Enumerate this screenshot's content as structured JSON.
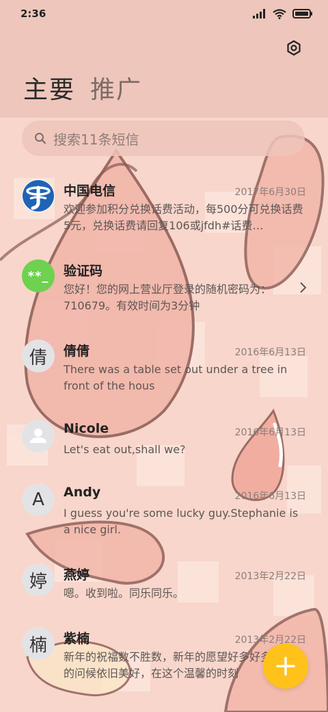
{
  "status_bar": {
    "time": "2:36"
  },
  "tabs": [
    {
      "label": "主要",
      "active": true
    },
    {
      "label": "推广",
      "active": false
    }
  ],
  "search": {
    "placeholder": "搜索11条短信"
  },
  "conversations": [
    {
      "name": "中国电信",
      "date": "2017年6月30日",
      "preview": "欢迎参加积分兑换话费活动，每500分可兑换话费5元，兑换话费请回复106或jfdh#话费…",
      "avatar": "telecom-logo"
    },
    {
      "name": "验证码",
      "date": "",
      "preview": "您好！您的网上营业厅登录的随机密码为：710679。有效时间为3分钟",
      "avatar_text": "**_"
    },
    {
      "name": "倩倩",
      "date": "2016年6月13日",
      "preview": "There was a table set out under a tree in front of the hous",
      "avatar_text": "倩"
    },
    {
      "name": "Nicole",
      "date": "2016年6月13日",
      "preview": "Let's eat out,shall we?",
      "avatar": "person-icon"
    },
    {
      "name": "Andy",
      "date": "2016年6月13日",
      "preview": "I guess you're some lucky guy.Stephanie is a nice girl.",
      "avatar_text": "A"
    },
    {
      "name": "燕婷",
      "date": "2013年2月22日",
      "preview": "嗯。收到啦。同乐同乐。",
      "avatar_text": "婷"
    },
    {
      "name": "紫楠",
      "date": "2013年2月22日",
      "preview": "新年的祝福数不胜数，新年的愿望好多好多，新年的问候依旧美好，在这个温馨的时刻",
      "avatar_text": "楠"
    }
  ],
  "colors": {
    "fab": "#ffc21a",
    "header": "#eec6bb",
    "verify_avatar": "#6ed14f",
    "telecom_blue": "#1f63b6"
  },
  "icons": {
    "settings": "settings-icon",
    "search": "search-icon",
    "compose": "plus-icon",
    "chevron": "chevron-right-icon"
  }
}
